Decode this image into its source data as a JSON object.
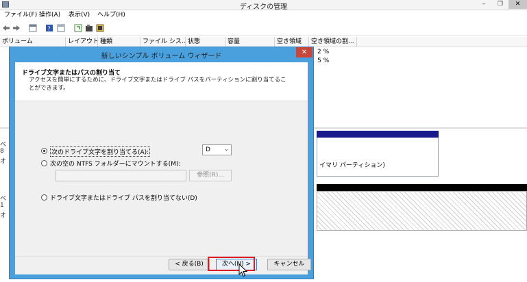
{
  "window": {
    "title": "ディスクの管理",
    "controls": [
      "–",
      "❐",
      "✕"
    ]
  },
  "menubar": [
    "ファイル(F)",
    "操作(A)",
    "表示(V)",
    "ヘルプ(H)"
  ],
  "toolbar_icons": [
    "back-arrow-icon",
    "forward-arrow-icon",
    "list-view-icon",
    "help-icon",
    "properties-icon",
    "refresh-icon",
    "key-icon",
    "settings-icon"
  ],
  "volume_list": {
    "columns": [
      "ボリューム",
      "レイアウト",
      "種類",
      "ファイル シス...",
      "状態",
      "容量",
      "空き領域",
      "空き領域の割..."
    ],
    "rows": [
      {
        "free_pct": "2 %"
      },
      {
        "free_pct": "5 %"
      }
    ]
  },
  "lower_pane": {
    "partition_label": "イマリ パーティション)",
    "left_fragments": [
      "ベ",
      "8",
      "オ",
      "ベ",
      "1",
      "オ"
    ]
  },
  "wizard": {
    "title": "新しいシンプル ボリューム ウィザード",
    "close": "✕",
    "header_title": "ドライブ文字またはパスの割り当て",
    "header_desc": "アクセスを簡単にするために、ドライブ文字またはドライブ パスをパーティションに割り当てることができます。",
    "options": [
      {
        "label": "次のドライブ文字を割り当てる(A):",
        "checked": true
      },
      {
        "label": "次の空の NTFS フォルダーにマウントする(M):",
        "checked": false
      },
      {
        "label": "ドライブ文字またはドライブ パスを割り当てない(D)",
        "checked": false
      }
    ],
    "drive_letter": "D",
    "folder_path": "",
    "browse_label": "参照(R)...",
    "back_label": "< 戻る(B)",
    "next_label": "次へ(N) >",
    "cancel_label": "キャンセル"
  },
  "colors": {
    "dialog_frame": "#4aa0dd",
    "highlight": "#e21a22",
    "disk_bar": "#1a1a8c"
  }
}
